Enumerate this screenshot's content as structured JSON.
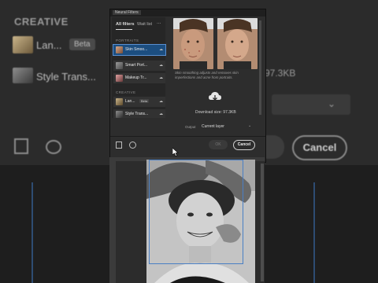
{
  "background": {
    "section_label": "CREATIVE",
    "item1_label": "Lan...",
    "item1_badge": "Beta",
    "item2_label": "Style Trans...",
    "download_size_fragment": "97.3KB",
    "cancel_label": "Cancel"
  },
  "dialog": {
    "title_tab": "Neural Filters",
    "tabs": [
      {
        "label": "All filters",
        "active": true
      },
      {
        "label": "Wait list",
        "active": false
      }
    ],
    "more_glyph": "···",
    "sections": {
      "portraits": "PORTRAITS",
      "creative": "CREATIVE"
    },
    "filters": [
      {
        "label": "Skin Smoo...",
        "selected": true,
        "icon": "cloud-download-icon"
      },
      {
        "label": "Smart Port...",
        "selected": false,
        "icon": "cloud-download-icon"
      },
      {
        "label": "Makeup Tr...",
        "selected": false,
        "icon": "cloud-download-icon"
      },
      {
        "label": "Lan...",
        "badge": "Beta",
        "selected": false,
        "icon": "cloud-download-icon"
      },
      {
        "label": "Style Trans...",
        "selected": false,
        "icon": "cloud-download-icon"
      }
    ],
    "description": "Skin smoothing adjusts and removes skin imperfections and acne from portraits.",
    "download_label": "Download size: 97.3KB",
    "output": {
      "label": "Output",
      "value": "Current layer"
    },
    "ok_label": "OK",
    "cancel_label": "Cancel",
    "accent_color": "#1c4e80"
  }
}
